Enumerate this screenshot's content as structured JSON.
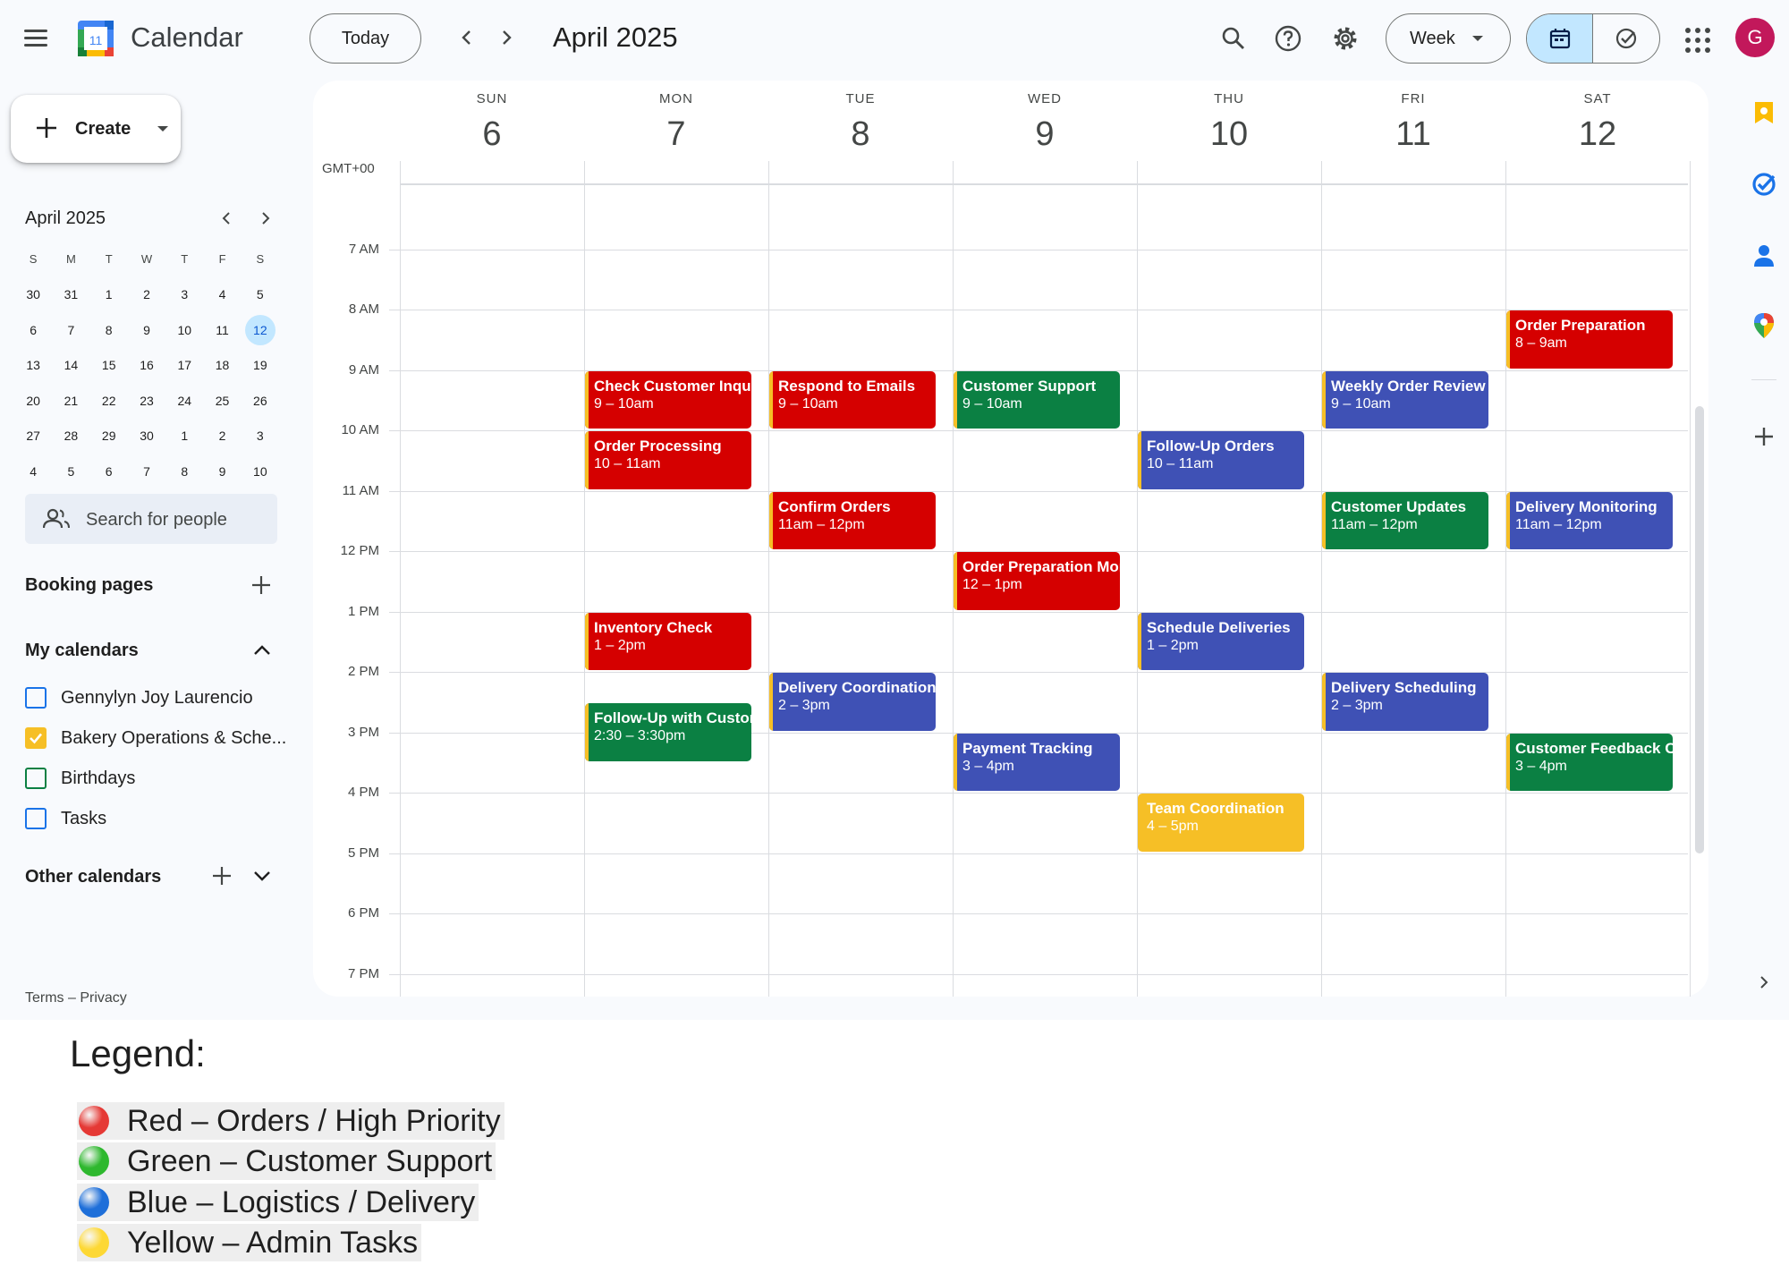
{
  "header": {
    "app_title": "Calendar",
    "logo_day": "11",
    "today_label": "Today",
    "current_range": "April 2025",
    "view_label": "Week",
    "avatar_initial": "G"
  },
  "sidebar": {
    "create_label": "Create",
    "mini_calendar": {
      "title": "April 2025",
      "weekday_heads": [
        "S",
        "M",
        "T",
        "W",
        "T",
        "F",
        "S"
      ],
      "weeks": [
        [
          "30",
          "31",
          "1",
          "2",
          "3",
          "4",
          "5"
        ],
        [
          "6",
          "7",
          "8",
          "9",
          "10",
          "11",
          "12"
        ],
        [
          "13",
          "14",
          "15",
          "16",
          "17",
          "18",
          "19"
        ],
        [
          "20",
          "21",
          "22",
          "23",
          "24",
          "25",
          "26"
        ],
        [
          "27",
          "28",
          "29",
          "30",
          "1",
          "2",
          "3"
        ],
        [
          "4",
          "5",
          "6",
          "7",
          "8",
          "9",
          "10"
        ]
      ],
      "selected_day": "12"
    },
    "search_people_placeholder": "Search for people",
    "booking_pages_label": "Booking pages",
    "my_calendars_label": "My calendars",
    "my_calendars": [
      {
        "label": "Gennylyn Joy Laurencio",
        "color": "#1a73e8",
        "checked": false
      },
      {
        "label": "Bakery Operations & Sche...",
        "color": "#f6bf26",
        "checked": true
      },
      {
        "label": "Birthdays",
        "color": "#0b8043",
        "checked": false
      },
      {
        "label": "Tasks",
        "color": "#1a73e8",
        "checked": false
      }
    ],
    "other_calendars_label": "Other calendars",
    "footer": "Terms – Privacy"
  },
  "week": {
    "timezone": "GMT+00",
    "days": [
      {
        "name": "SUN",
        "num": "6"
      },
      {
        "name": "MON",
        "num": "7"
      },
      {
        "name": "TUE",
        "num": "8"
      },
      {
        "name": "WED",
        "num": "9"
      },
      {
        "name": "THU",
        "num": "10"
      },
      {
        "name": "FRI",
        "num": "11"
      },
      {
        "name": "SAT",
        "num": "12"
      }
    ],
    "hours": [
      "7 AM",
      "8 AM",
      "9 AM",
      "10 AM",
      "11 AM",
      "12 PM",
      "1 PM",
      "2 PM",
      "3 PM",
      "4 PM",
      "5 PM",
      "6 PM",
      "7 PM"
    ],
    "events": [
      {
        "day": 1,
        "start": 9,
        "end": 10,
        "title": "Check Customer Inquiries",
        "time": "9 – 10am",
        "color": "red"
      },
      {
        "day": 1,
        "start": 10,
        "end": 11,
        "title": "Order Processing",
        "time": "10 – 11am",
        "color": "red"
      },
      {
        "day": 1,
        "start": 13,
        "end": 14,
        "title": "Inventory Check",
        "time": "1 – 2pm",
        "color": "red"
      },
      {
        "day": 1,
        "start": 14.5,
        "end": 15.5,
        "title": "Follow-Up with Customers",
        "time": "2:30 – 3:30pm",
        "color": "green"
      },
      {
        "day": 2,
        "start": 9,
        "end": 10,
        "title": "Respond to Emails",
        "time": "9 – 10am",
        "color": "red"
      },
      {
        "day": 2,
        "start": 11,
        "end": 12,
        "title": "Confirm Orders",
        "time": "11am – 12pm",
        "color": "red"
      },
      {
        "day": 2,
        "start": 14,
        "end": 15,
        "title": "Delivery Coordination",
        "time": "2 – 3pm",
        "color": "blue"
      },
      {
        "day": 3,
        "start": 9,
        "end": 10,
        "title": "Customer Support",
        "time": "9 – 10am",
        "color": "green"
      },
      {
        "day": 3,
        "start": 12,
        "end": 13,
        "title": "Order Preparation Monitoring",
        "time": "12 – 1pm",
        "color": "red"
      },
      {
        "day": 3,
        "start": 15,
        "end": 16,
        "title": "Payment Tracking",
        "time": "3 – 4pm",
        "color": "blue"
      },
      {
        "day": 4,
        "start": 10,
        "end": 11,
        "title": "Follow-Up Orders",
        "time": "10 – 11am",
        "color": "blue"
      },
      {
        "day": 4,
        "start": 13,
        "end": 14,
        "title": "Schedule Deliveries",
        "time": "1 – 2pm",
        "color": "blue"
      },
      {
        "day": 4,
        "start": 16,
        "end": 17,
        "title": "Team Coordination",
        "time": "4 – 5pm",
        "color": "yellow"
      },
      {
        "day": 5,
        "start": 9,
        "end": 10,
        "title": "Weekly Order Review",
        "time": "9 – 10am",
        "color": "blue"
      },
      {
        "day": 5,
        "start": 11,
        "end": 12,
        "title": "Customer Updates",
        "time": "11am – 12pm",
        "color": "green"
      },
      {
        "day": 5,
        "start": 14,
        "end": 15,
        "title": "Delivery Scheduling",
        "time": "2 – 3pm",
        "color": "blue"
      },
      {
        "day": 6,
        "start": 8,
        "end": 9,
        "title": "Order Preparation",
        "time": "8 – 9am",
        "color": "red"
      },
      {
        "day": 6,
        "start": 11,
        "end": 12,
        "title": "Delivery Monitoring",
        "time": "11am – 12pm",
        "color": "blue"
      },
      {
        "day": 6,
        "start": 15,
        "end": 16,
        "title": "Customer Feedback Check",
        "time": "3 – 4pm",
        "color": "green"
      }
    ]
  },
  "colors": {
    "red": "#d50000",
    "green": "#0b8043",
    "blue": "#3f51b5",
    "yellow": "#f6bf26",
    "accent": "#0b57d0",
    "selected_bg": "#c2e7ff"
  },
  "legend": {
    "title": "Legend:",
    "items": [
      {
        "label": "Red – Orders / High Priority",
        "color": "#e53935"
      },
      {
        "label": "Green – Customer Support",
        "color": "#2eb82e"
      },
      {
        "label": "Blue – Logistics / Delivery",
        "color": "#1e6fd9"
      },
      {
        "label": "Yellow – Admin Tasks",
        "color": "#fdd835"
      }
    ]
  }
}
